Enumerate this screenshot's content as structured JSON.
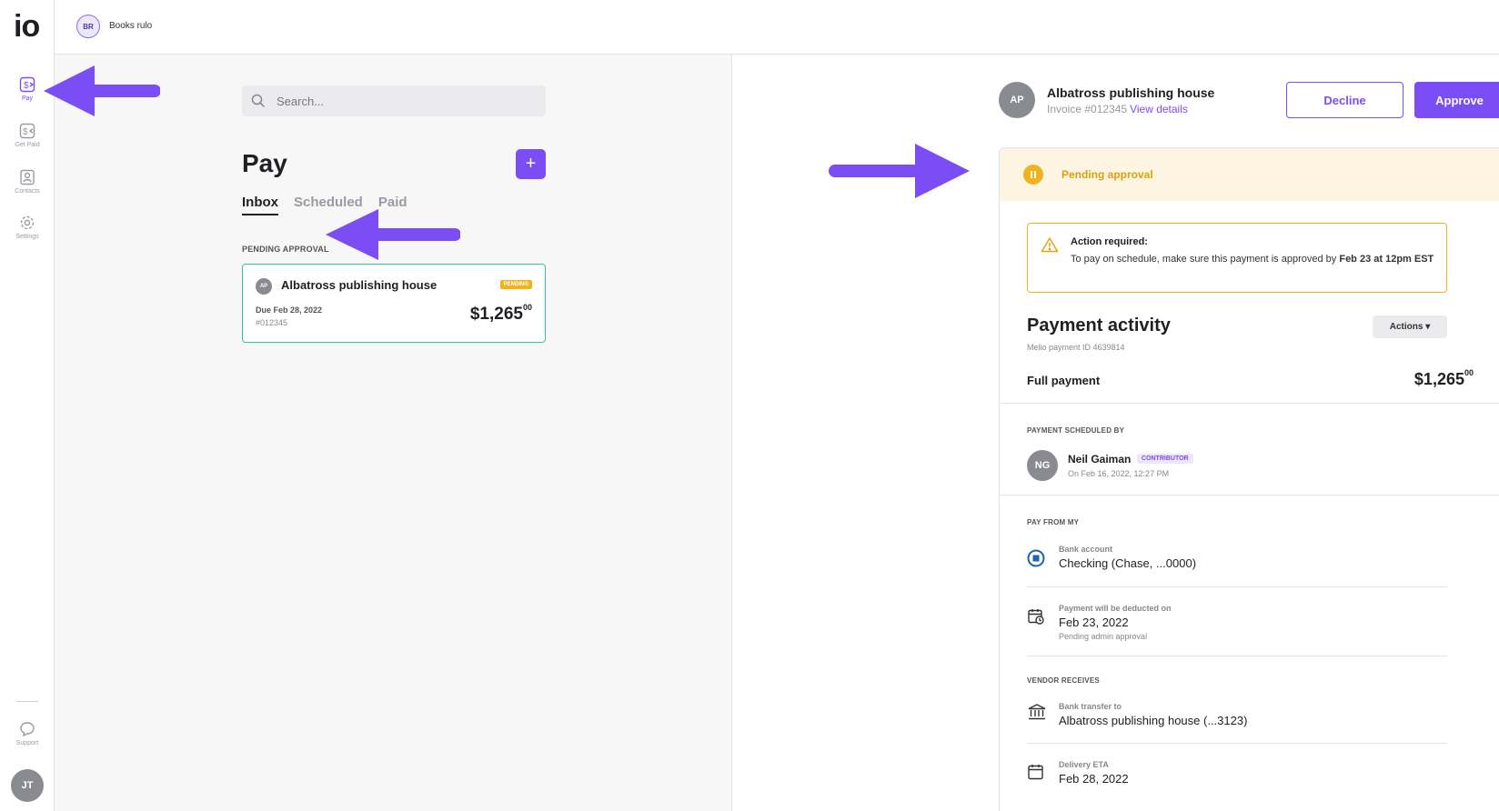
{
  "app": {
    "logo": "io",
    "org": {
      "initials": "BR",
      "name": "Books rulo"
    },
    "user_initials": "JT"
  },
  "nav": {
    "items": [
      {
        "label": "Pay",
        "icon": "pay-icon",
        "active": true
      },
      {
        "label": "Get Paid",
        "icon": "get-paid-icon",
        "active": false
      },
      {
        "label": "Contacts",
        "icon": "contacts-icon",
        "active": false
      },
      {
        "label": "Settings",
        "icon": "gear-icon",
        "active": false
      }
    ],
    "support": {
      "label": "Support",
      "icon": "chat-bubble-icon"
    }
  },
  "list": {
    "search_placeholder": "Search...",
    "title": "Pay",
    "add_label": "+",
    "tabs": [
      "Inbox",
      "Scheduled",
      "Paid"
    ],
    "active_tab": "Inbox",
    "section_label": "PENDING APPROVAL",
    "card": {
      "initials": "AP",
      "vendor": "Albatross publishing house",
      "badge": "PENDING",
      "due": "Due Feb 28, 2022",
      "invoice": "#012345",
      "amount_main": "$1,265",
      "amount_cents": "00"
    }
  },
  "detail": {
    "initials": "AP",
    "vendor": "Albatross publishing house",
    "invoice": "Invoice #012345",
    "view_details": "View details",
    "decline_label": "Decline",
    "approve_label": "Approve",
    "status": "Pending approval",
    "alert": {
      "title": "Action required:",
      "body_prefix": "To pay on schedule, make sure this payment is approved by ",
      "body_strong": "Feb 23 at 12pm EST"
    },
    "activity": {
      "title": "Payment activity",
      "payment_id": "Melio payment ID 4639814",
      "actions_label": "Actions ▾",
      "full_label": "Full payment",
      "amount_main": "$1,265",
      "amount_cents": "00"
    },
    "scheduled_by": {
      "label": "PAYMENT SCHEDULED BY",
      "initials": "NG",
      "name": "Neil Gaiman",
      "role": "CONTRIBUTOR",
      "date": "On Feb 16, 2022, 12:27 PM"
    },
    "pay_from": {
      "label": "PAY FROM MY",
      "bank_small": "Bank account",
      "bank_main": "Checking (Chase, ...0000)",
      "deduct_small": "Payment will be deducted on",
      "deduct_main": "Feb 23, 2022",
      "deduct_note": "Pending admin approval"
    },
    "vendor_receives": {
      "label": "VENDOR RECEIVES",
      "transfer_small": "Bank transfer to",
      "transfer_main": "Albatross publishing house (...3123)",
      "eta_small": "Delivery ETA",
      "eta_main": "Feb 28, 2022"
    }
  },
  "colors": {
    "accent": "#7b4df5",
    "pending": "#f1b31c",
    "card_border": "#35c2a0",
    "arrow": "#7b4df5"
  }
}
